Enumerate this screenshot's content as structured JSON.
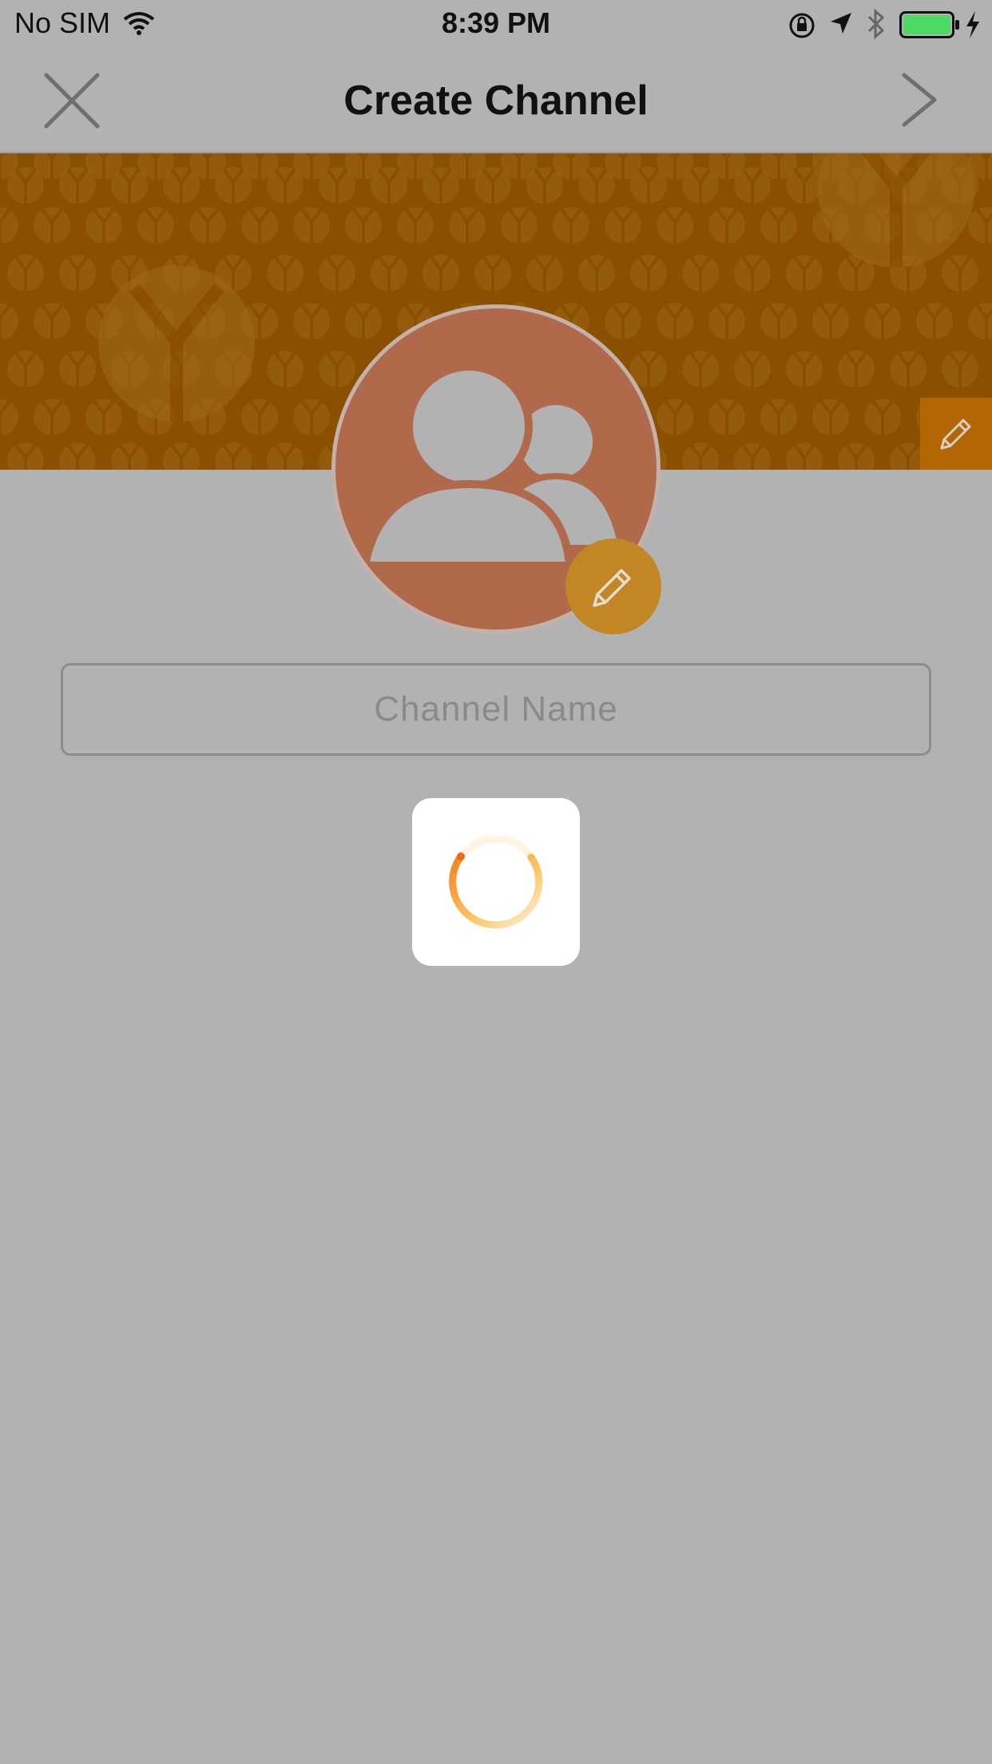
{
  "status_bar": {
    "carrier": "No SIM",
    "time": "8:39 PM",
    "battery_color": "#4cd964"
  },
  "nav": {
    "title": "Create Channel",
    "left_icon": "close-icon",
    "right_icon": "chevron-right-icon"
  },
  "cover": {
    "background_color": "#8a5000",
    "edit_icon": "pencil-icon"
  },
  "avatar": {
    "icon": "group-users-icon",
    "background_color": "#b0694a",
    "edit_icon": "pencil-icon"
  },
  "form": {
    "channel_name_placeholder": "Channel Name",
    "channel_name_value": ""
  },
  "loading": {
    "icon": "spinner-icon",
    "accent_color": "#f58220"
  }
}
